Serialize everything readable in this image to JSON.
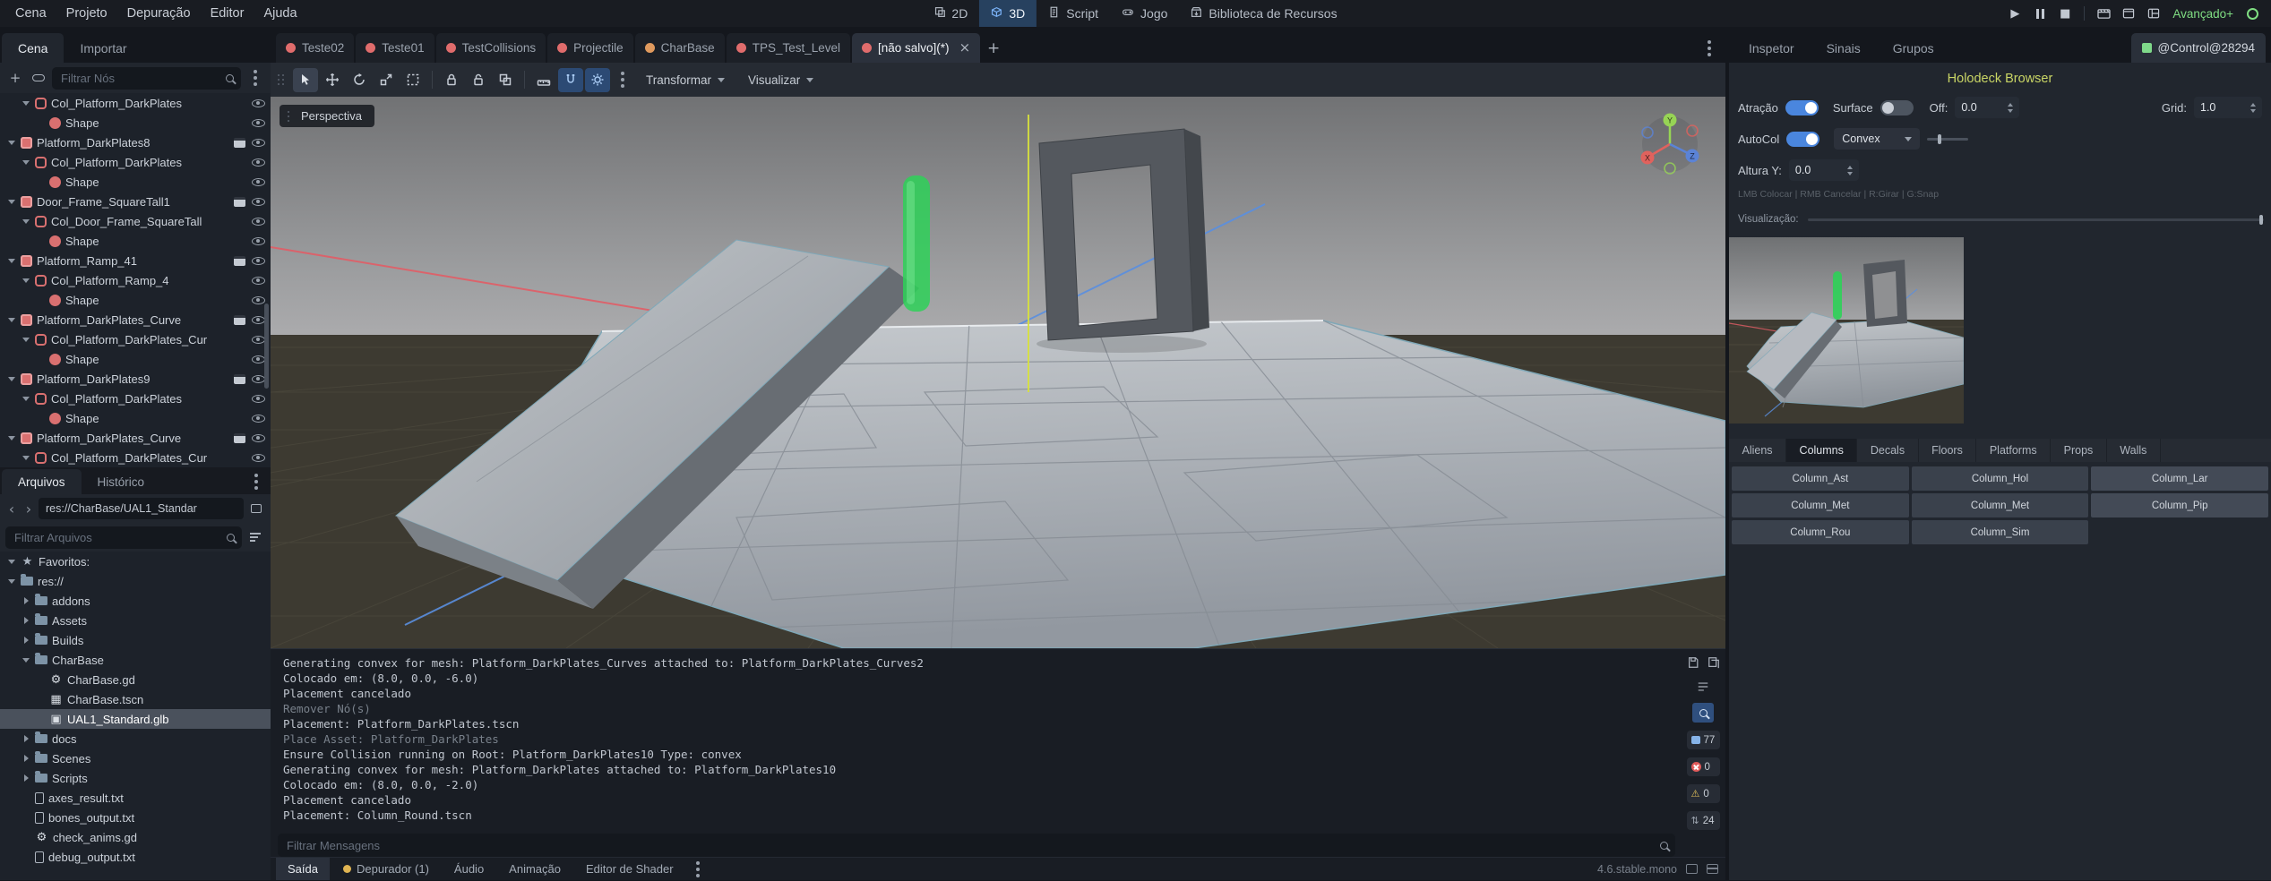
{
  "icons": {
    "star": "★",
    "gear": "⚙",
    "scene_file": "▦",
    "mesh_file": "▣",
    "play": "▶",
    "stop": "■",
    "close": "×",
    "add": "+",
    "back": "‹",
    "forward": "›",
    "warning": "⚠",
    "updown": "⇅"
  },
  "topbar": {
    "menus": [
      "Cena",
      "Projeto",
      "Depuração",
      "Editor",
      "Ajuda"
    ],
    "switcher": [
      "2D",
      "3D",
      "Script",
      "Jogo",
      "Biblioteca de Recursos"
    ],
    "advanced_label": "Avançado+"
  },
  "scene_tabs": {
    "labels": [
      "Teste02",
      "Teste01",
      "TestCollisions",
      "Projectile",
      "CharBase",
      "TPS_Test_Level",
      "[não salvo](*)"
    ]
  },
  "left_dock": {
    "tabs": [
      "Cena",
      "Importar"
    ],
    "filter_placeholder": "Filtrar Nós",
    "tree": [
      {
        "label": "Col_Platform_DarkPlates"
      },
      {
        "label": "Shape"
      },
      {
        "label": "Platform_DarkPlates8"
      },
      {
        "label": "Col_Platform_DarkPlates"
      },
      {
        "label": "Shape"
      },
      {
        "label": "Door_Frame_SquareTall1"
      },
      {
        "label": "Col_Door_Frame_SquareTall"
      },
      {
        "label": "Shape"
      },
      {
        "label": "Platform_Ramp_41"
      },
      {
        "label": "Col_Platform_Ramp_4"
      },
      {
        "label": "Shape"
      },
      {
        "label": "Platform_DarkPlates_Curve"
      },
      {
        "label": "Col_Platform_DarkPlates_Cur"
      },
      {
        "label": "Shape"
      },
      {
        "label": "Platform_DarkPlates9"
      },
      {
        "label": "Col_Platform_DarkPlates"
      },
      {
        "label": "Shape"
      },
      {
        "label": "Platform_DarkPlates_Curve"
      },
      {
        "label": "Col_Platform_DarkPlates_Cur"
      }
    ]
  },
  "filesystem": {
    "tabs": [
      "Arquivos",
      "Histórico"
    ],
    "path": "res://CharBase/UAL1_Standar",
    "filter_placeholder": "Filtrar Arquivos",
    "items": [
      {
        "label": "Favoritos:"
      },
      {
        "label": "res://"
      },
      {
        "label": "addons"
      },
      {
        "label": "Assets"
      },
      {
        "label": "Builds"
      },
      {
        "label": "CharBase"
      },
      {
        "label": "CharBase.gd"
      },
      {
        "label": "CharBase.tscn"
      },
      {
        "label": "UAL1_Standard.glb"
      },
      {
        "label": "docs"
      },
      {
        "label": "Scenes"
      },
      {
        "label": "Scripts"
      },
      {
        "label": "axes_result.txt"
      },
      {
        "label": "bones_output.txt"
      },
      {
        "label": "check_anims.gd"
      },
      {
        "label": "debug_output.txt"
      }
    ]
  },
  "viewport": {
    "menus": [
      "Transformar",
      "Visualizar"
    ],
    "view_label": "Perspectiva"
  },
  "output": {
    "lines": [
      "Generating convex for mesh: Platform_DarkPlates_Curves attached to: Platform_DarkPlates_Curves2",
      "Colocado em: (8.0, 0.0, -6.0)",
      "Placement cancelado",
      "Remover Nó(s)",
      "Placement: Platform_DarkPlates.tscn",
      "Place Asset: Platform_DarkPlates",
      "Ensure Collision running on Root: Platform_DarkPlates10 Type: convex",
      "Generating convex for mesh: Platform_DarkPlates attached to: Platform_DarkPlates10",
      "Colocado em: (8.0, 0.0, -2.0)",
      "Placement cancelado",
      "Placement: Column_Round.tscn"
    ],
    "filter_placeholder": "Filtrar Mensagens",
    "badges": {
      "messages": "77",
      "errors": "0",
      "warnings": "0",
      "lines": "24"
    },
    "tabs": [
      "Saída",
      "Depurador (1)",
      "Áudio",
      "Animação",
      "Editor de Shader"
    ],
    "version": "4.6.stable.mono"
  },
  "inspector": {
    "tabs": [
      "Inspetor",
      "Sinais",
      "Grupos"
    ],
    "object_name": "@Control@28294",
    "title": "Holodeck Browser",
    "props": {
      "atracao": "Atração",
      "surface": "Surface",
      "off": "Off:",
      "off_value": "0.0",
      "grid": "Grid:",
      "grid_value": "1.0",
      "autocol": "AutoCol",
      "convex": "Convex",
      "altura": "Altura Y:",
      "altura_value": "0.0",
      "hint": "LMB Colocar | RMB Cancelar | R:Girar | G:Snap",
      "viz": "Visualização:"
    },
    "categories": [
      "Aliens",
      "Columns",
      "Decals",
      "Floors",
      "Platforms",
      "Props",
      "Walls"
    ],
    "assets": [
      "Column_Ast",
      "Column_Hol",
      "Column_Lar",
      "Column_Met",
      "Column_Met",
      "Column_Pip",
      "Column_Rou",
      "Column_Sim"
    ]
  }
}
